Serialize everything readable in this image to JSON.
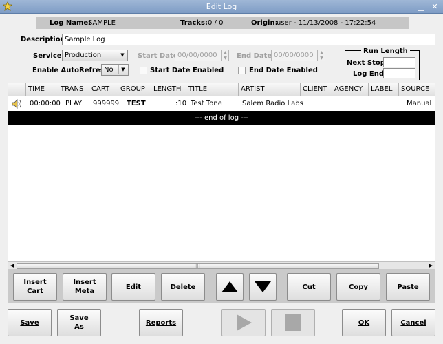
{
  "window": {
    "title": "Edit Log"
  },
  "info": {
    "log_name_label": "Log Name:",
    "log_name": "SAMPLE",
    "tracks_label": "Tracks:",
    "tracks": "0 / 0",
    "origin_label": "Origin:",
    "origin": "user - 11/13/2008 - 17:22:54"
  },
  "form": {
    "description_label": "Description:",
    "description": "Sample Log",
    "service_label": "Service:",
    "service": "Production",
    "refresh_label": "Enable AutoRefresh:",
    "refresh": "No",
    "start_date_label": "Start Date:",
    "start_date": "00/00/0000",
    "end_date_label": "End Date:",
    "end_date": "00/00/0000",
    "start_enabled_label": "Start Date Enabled",
    "end_enabled_label": "End Date Enabled"
  },
  "run_length": {
    "title": "Run Length",
    "next_stop_label": "Next Stop:",
    "log_end_label": "Log End:"
  },
  "table": {
    "columns": [
      "TIME",
      "TRANS",
      "CART",
      "GROUP",
      "LENGTH",
      "TITLE",
      "ARTIST",
      "CLIENT",
      "AGENCY",
      "LABEL",
      "SOURCE"
    ],
    "rows": [
      {
        "time": "00:00:00",
        "trans": "PLAY",
        "cart": "999999",
        "group": "TEST",
        "length": ":10",
        "title": "Test Tone",
        "artist": "Salem Radio Labs",
        "client": "",
        "agency": "",
        "label": "",
        "source": "Manual"
      }
    ],
    "end_marker": "--- end of log ---"
  },
  "panel_buttons": {
    "insert_cart_1": "Insert",
    "insert_cart_2": "Cart",
    "insert_meta_1": "Insert",
    "insert_meta_2": "Meta",
    "edit": "Edit",
    "delete": "Delete",
    "cut": "Cut",
    "copy": "Copy",
    "paste": "Paste"
  },
  "bottom_buttons": {
    "save": "Save",
    "save_as_1": "Save",
    "save_as_2": "As",
    "reports": "Reports",
    "ok": "OK",
    "cancel": "Cancel"
  }
}
